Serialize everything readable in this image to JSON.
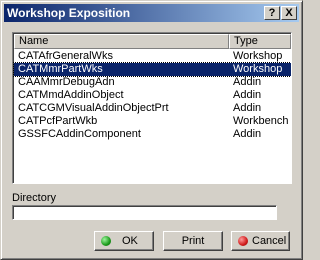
{
  "window": {
    "title": "Workshop Exposition",
    "help_glyph": "?",
    "close_glyph": "X"
  },
  "list": {
    "columns": [
      "Name",
      "Type"
    ],
    "rows": [
      {
        "name": "CATAfrGeneralWks",
        "type": "Workshop"
      },
      {
        "name": "CATMmrPartWks",
        "type": "Workshop"
      },
      {
        "name": "CAAMmrDebugAdn",
        "type": "Addin"
      },
      {
        "name": "CATMmdAddinObject",
        "type": "Addin"
      },
      {
        "name": "CATCGMVisualAddinObjectPrt",
        "type": "Addin"
      },
      {
        "name": "CATPcfPartWkb",
        "type": "Workbench"
      },
      {
        "name": "GSSFCAddinComponent",
        "type": "Addin"
      }
    ],
    "selected_index": 1
  },
  "directory": {
    "label": "Directory",
    "value": ""
  },
  "buttons": {
    "ok": "OK",
    "print": "Print",
    "cancel": "Cancel"
  },
  "colors": {
    "titlebar_start": "#0a246a",
    "titlebar_end": "#a6caf0",
    "selection": "#0a246a",
    "ok_icon": "#1a9a1a",
    "cancel_icon": "#d01a1a"
  }
}
